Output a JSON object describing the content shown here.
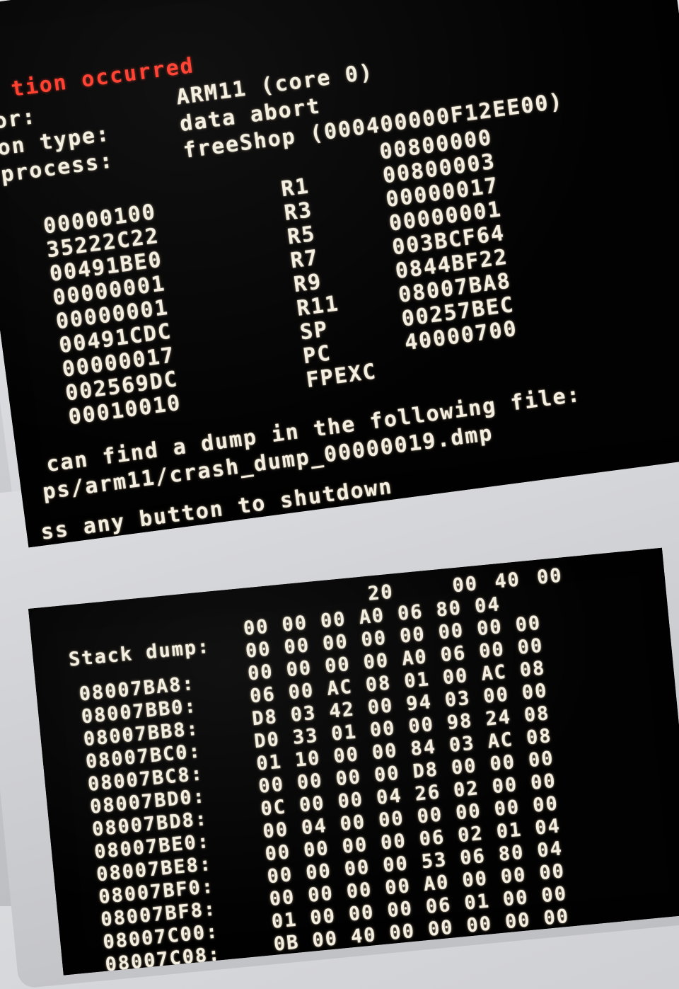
{
  "top_screen": {
    "title": "tion occurred",
    "info": [
      {
        "label": "or:",
        "value": "ARM11 (core 0)"
      },
      {
        "label": "on type:",
        "value": "data abort"
      },
      {
        "label": "process:",
        "value": "freeShop (000400000F12EE00)"
      }
    ],
    "left_values": [
      "00000100",
      "35222C22",
      "00491BE0",
      "00000001",
      "00000001",
      "00491CDC",
      "00000017",
      "002569DC",
      "00010010"
    ],
    "right_registers": [
      {
        "name": "",
        "value": "00800000"
      },
      {
        "name": "R1",
        "value": "00800003"
      },
      {
        "name": "R3",
        "value": "00000017"
      },
      {
        "name": "R5",
        "value": "00000001"
      },
      {
        "name": "R7",
        "value": "003BCF64"
      },
      {
        "name": "R9",
        "value": "0844BF22"
      },
      {
        "name": "R11",
        "value": "08007BA8"
      },
      {
        "name": "SP",
        "value": "00257BEC"
      },
      {
        "name": "PC",
        "value": "40000700"
      },
      {
        "name": "FPEXC",
        "value": ""
      }
    ],
    "message_lines": [
      "can find a dump in the following file:",
      "ps/arm11/crash_dump_00000019.dmp",
      "ss any button to shutdown"
    ]
  },
  "bottom_screen": {
    "title": "Stack dump:",
    "header_bytes": [
      "20",
      "00",
      "40",
      "00"
    ],
    "rows": [
      {
        "addr": "",
        "bytes": "00 00 00 A0 06 80 04"
      },
      {
        "addr": "",
        "bytes": "00 00 00 00 00 00 00 00"
      },
      {
        "addr": "08007BA8:",
        "bytes": "00 00 00 00 A0 06 00 00"
      },
      {
        "addr": "08007BB0:",
        "bytes": "06 00 AC 08 01 00 AC 08"
      },
      {
        "addr": "08007BB8:",
        "bytes": "D8 03 42 00 94 03 00 00"
      },
      {
        "addr": "08007BC0:",
        "bytes": "D0 33 01 00 00 98 24 08"
      },
      {
        "addr": "08007BC8:",
        "bytes": "01 10 00 00 84 03 AC 08"
      },
      {
        "addr": "08007BD0:",
        "bytes": "00 00 00 00 D8 00 00 00"
      },
      {
        "addr": "08007BD8:",
        "bytes": "0C 00 00 04 26 02 00 00"
      },
      {
        "addr": "08007BE0:",
        "bytes": "00 04 00 00 00 00 00 00"
      },
      {
        "addr": "08007BE8:",
        "bytes": "00 00 00 00 06 02 01 04"
      },
      {
        "addr": "08007BF0:",
        "bytes": "00 00 00 00 53 06 80 04"
      },
      {
        "addr": "08007BF8:",
        "bytes": "00 00 00 00 A0 00 00 00"
      },
      {
        "addr": "08007C00:",
        "bytes": "01 00 00 00 06 01 00 00"
      },
      {
        "addr": "08007C08:",
        "bytes": "0B 00 40 00 00 00 00 00"
      }
    ]
  }
}
